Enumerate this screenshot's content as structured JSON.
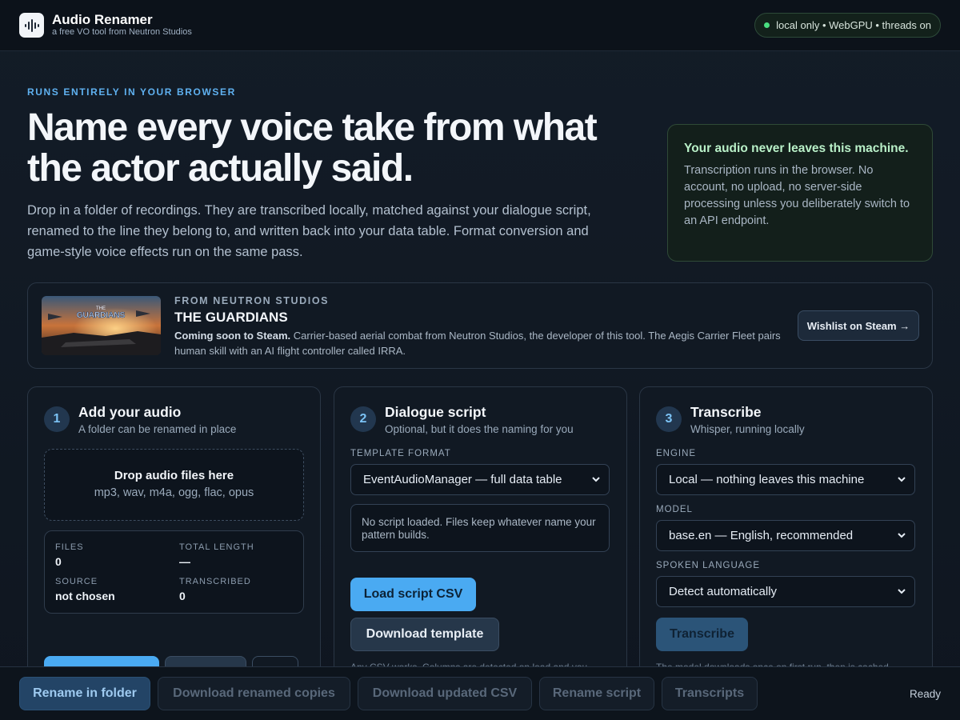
{
  "app": {
    "title": "Audio Renamer",
    "subtitle": "a free VO tool from Neutron Studios",
    "logo_icon": "waveform-icon",
    "status": "local only • WebGPU • threads on"
  },
  "hero": {
    "kicker": "RUNS ENTIRELY IN YOUR BROWSER",
    "headline": "Name every voice take from what the actor actually said.",
    "lede": "Drop in a folder of recordings. They are transcribed locally, matched against your dialogue script, renamed to the line they belong to, and written back into your data table. Format conversion and game-style voice effects run on the same pass.",
    "privacy_title": "Your audio never leaves this machine.",
    "privacy_text": "Transcription runs in the browser. No account, no upload, no server-side processing unless you deliberately switch to an API endpoint."
  },
  "promo": {
    "kicker": "FROM NEUTRON STUDIOS",
    "title": "THE GUARDIANS",
    "image_text": "THE GUARDIANS",
    "desc_bold": "Coming soon to Steam.",
    "desc": " Carrier-based aerial combat from Neutron Studios, the developer of this tool. The Aegis Carrier Fleet pairs human skill with an AI flight controller called IRRA.",
    "button": "Wishlist on Steam →"
  },
  "steps": {
    "one": {
      "num": "1",
      "title": "Add your audio",
      "sub": "A folder can be renamed in place",
      "drop_title": "Drop audio files here",
      "drop_sub": "mp3, wav, m4a, ogg, flac, opus",
      "stats": {
        "files_label": "FILES",
        "files": "0",
        "length_label": "TOTAL LENGTH",
        "length": "—",
        "source_label": "SOURCE",
        "source": "not chosen",
        "transcribed_label": "TRANSCRIBED",
        "transcribed": "0"
      }
    },
    "two": {
      "num": "2",
      "title": "Dialogue script",
      "sub": "Optional, but it does the naming for you",
      "format_label": "TEMPLATE FORMAT",
      "format_value": "EventAudioManager — full data table",
      "notice": "No script loaded. Files keep whatever name your pattern builds.",
      "load_btn": "Load script CSV",
      "template_btn": "Download template",
      "note": "Any CSV works. Columns are detected on load and you"
    },
    "three": {
      "num": "3",
      "title": "Transcribe",
      "sub": "Whisper, running locally",
      "engine_label": "ENGINE",
      "engine_value": "Local — nothing leaves this machine",
      "model_label": "MODEL",
      "model_value": "base.en — English, recommended",
      "lang_label": "SPOKEN LANGUAGE",
      "lang_value": "Detect automatically",
      "transcribe_btn": "Transcribe",
      "note": "The model downloads once on first run, then is cached"
    }
  },
  "actions": {
    "rename_folder": "Rename in folder",
    "download_copies": "Download renamed copies",
    "download_csv": "Download updated CSV",
    "rename_script": "Rename script",
    "transcripts": "Transcripts",
    "status": "Ready"
  }
}
